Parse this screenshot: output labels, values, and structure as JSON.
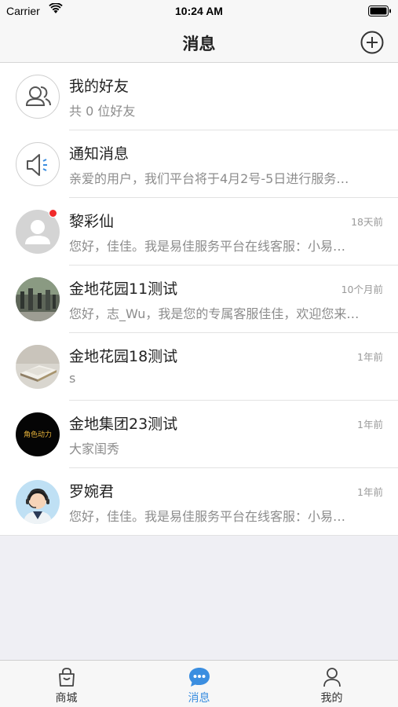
{
  "status_bar": {
    "carrier": "Carrier",
    "time": "10:24 AM"
  },
  "nav": {
    "title": "消息",
    "add_icon": "plus-circle-icon"
  },
  "messages": [
    {
      "name": "我的好友",
      "preview": "共 0 位好友",
      "time": "",
      "avatar": "friends-icon"
    },
    {
      "name": "通知消息",
      "preview": "亲爱的用户，我们平台将于4月2号-5日进行服务…",
      "time": "",
      "avatar": "speaker-icon"
    },
    {
      "name": "黎彩仙",
      "preview": "您好，佳佳。我是易佳服务平台在线客服：小易…",
      "time": "18天前",
      "avatar": "default-user-avatar",
      "unread": true
    },
    {
      "name": "金地花园11测试",
      "preview": "您好，志_Wu，我是您的专属客服佳佳，欢迎您来…",
      "time": "10个月前",
      "avatar": "street-photo-avatar"
    },
    {
      "name": "金地花园18测试",
      "preview": "s",
      "time": "1年前",
      "avatar": "papers-photo-avatar"
    },
    {
      "name": "金地集团23测试",
      "preview": "大家闺秀",
      "time": "1年前",
      "avatar": "dark-logo-avatar",
      "avatar_text": "角色动力"
    },
    {
      "name": "罗婉君",
      "preview": "您好，佳佳。我是易佳服务平台在线客服：小易…",
      "time": "1年前",
      "avatar": "support-agent-avatar"
    }
  ],
  "tabs": [
    {
      "label": "商城",
      "icon": "shopping-bag-icon",
      "active": false
    },
    {
      "label": "消息",
      "icon": "chat-bubble-icon",
      "active": true
    },
    {
      "label": "我的",
      "icon": "person-icon",
      "active": false
    }
  ],
  "colors": {
    "accent": "#3b8ee0",
    "unread": "#f02a2a",
    "background": "#efeff4"
  }
}
